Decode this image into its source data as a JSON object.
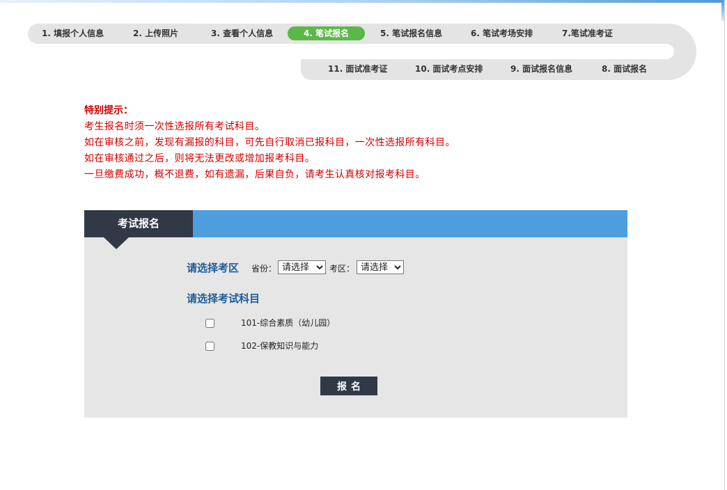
{
  "step_track": {
    "forward_row": [
      {
        "label": "1. 填报个人信息",
        "active": false
      },
      {
        "label": "2. 上传照片",
        "active": false
      },
      {
        "label": "3. 查看个人信息",
        "active": false
      },
      {
        "label": "4. 笔试报名",
        "active": true
      },
      {
        "label": "5. 笔试报名信息",
        "active": false
      },
      {
        "label": "6. 笔试考场安排",
        "active": false
      },
      {
        "label": "7.笔试准考证",
        "active": false
      }
    ],
    "return_row": [
      {
        "label": "11. 面试准考证",
        "active": false
      },
      {
        "label": "10. 面试考点安排",
        "active": false
      },
      {
        "label": "9. 面试报名信息",
        "active": false
      },
      {
        "label": "8. 面试报名",
        "active": false
      }
    ]
  },
  "notice": {
    "title": "特别提示：",
    "lines": [
      "考生报名时须一次性选报所有考试科目。",
      "如在审核之前，发现有漏报的科目，可先自行取消已报科目，一次性选报所有科目。",
      "如在审核通过之后，则将无法更改或增加报考科目。",
      "一旦缴费成功，概不退费，如有遗漏，后果自负，请考生认真核对报考科目。"
    ]
  },
  "registration_panel": {
    "tab_label": "考试报名",
    "region": {
      "heading": "请选择考区",
      "province": {
        "label": "省份：",
        "selected": "请选择"
      },
      "district": {
        "label": "考区：",
        "selected": "请选择"
      }
    },
    "subjects": {
      "heading": "请选择考试科目",
      "items": [
        {
          "label": "101-综合素质（幼儿园）",
          "checked": false
        },
        {
          "label": "102-保教知识与能力",
          "checked": false
        }
      ]
    },
    "submit_label": "报名"
  },
  "colors": {
    "track_gray": "#e4e4e4",
    "active_step": "#5cb748",
    "step_text": "#333333",
    "notice_red": "#d30000",
    "panel_tab_dark": "#313846",
    "panel_header_blue": "#4d9edc",
    "panel_body": "#e6e6e6",
    "heading_blue": "#1d5c98",
    "page_accent": "#4f9ad6"
  }
}
